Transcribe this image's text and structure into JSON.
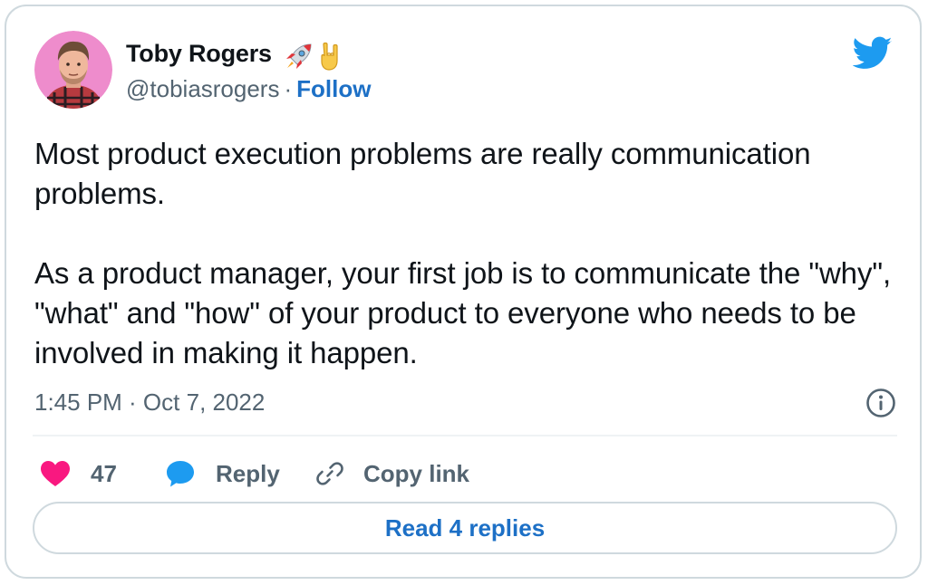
{
  "author": {
    "name": "Toby Rogers",
    "name_emojis": [
      "rocket-emoji",
      "sign-of-the-horns-emoji"
    ],
    "handle": "@tobiasrogers",
    "separator": "·",
    "follow_label": "Follow",
    "avatar_background": "#ee8ccc"
  },
  "tweet": {
    "paragraphs": [
      "Most product execution problems are really communication problems.",
      "As a product manager, your first job is to communicate the \"why\", \"what\" and \"how\" of your product to everyone who needs to be involved in making it happen."
    ],
    "timestamp": "1:45 PM · Oct 7, 2022"
  },
  "actions": {
    "like_count": "47",
    "reply_label": "Reply",
    "copy_link_label": "Copy link"
  },
  "read_replies_label": "Read 4 replies",
  "icons": {
    "brand": "twitter-bird-icon",
    "like": "heart-icon",
    "reply": "speech-bubble-icon",
    "copy": "link-icon",
    "info": "info-icon"
  },
  "colors": {
    "brand_blue": "#1d9bf0",
    "link_blue": "#1d70c6",
    "like_red": "#f91880",
    "secondary_text": "#536471",
    "border": "#cfd9de"
  }
}
